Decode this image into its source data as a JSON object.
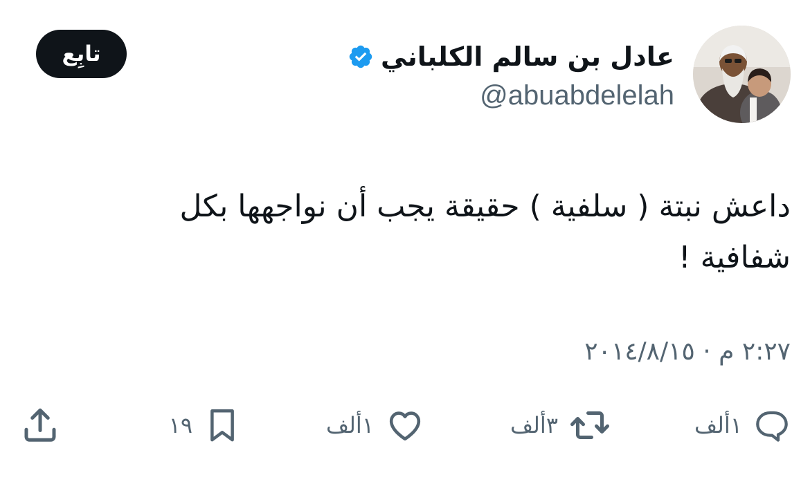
{
  "author": {
    "display_name": "عادل بن سالم الكلباني",
    "handle": "@abuabdelelah",
    "verified": true,
    "verified_icon": "verified-badge-icon",
    "verified_color": "#1d9bf0"
  },
  "follow_button": {
    "label": "تابِع"
  },
  "tweet": {
    "text": "داعش نبتة ( سلفية ) حقيقة يجب أن نواجهها بكل شفافية !",
    "timestamp": "٢:٢٧ م · ٢٠١٤/٨/١٥"
  },
  "actions": {
    "reply": {
      "icon": "reply-icon",
      "count": "١ألف"
    },
    "retweet": {
      "icon": "retweet-icon",
      "count": "٣ألف"
    },
    "like": {
      "icon": "heart-icon",
      "count": "١ألف"
    },
    "bookmark": {
      "icon": "bookmark-icon",
      "count": "١٩"
    },
    "share": {
      "icon": "share-icon"
    }
  },
  "colors": {
    "text_primary": "#0f1419",
    "text_secondary": "#536471",
    "follow_bg": "#0f1419",
    "follow_text": "#ffffff"
  }
}
